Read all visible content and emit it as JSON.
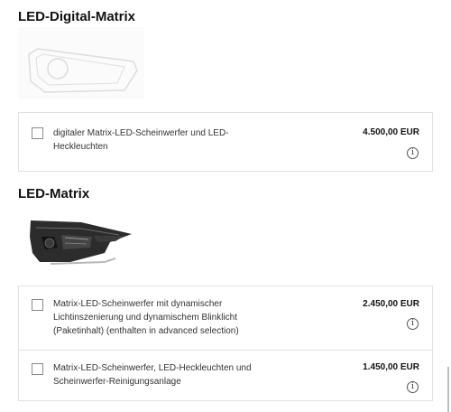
{
  "sections": [
    {
      "title": "LED-Digital-Matrix",
      "image_name": "led-digital-matrix-headlight-outline",
      "options": [
        {
          "text": "digitaler Matrix-LED-Scheinwerfer und LED-Heckleuchten",
          "price": "4.500,00 EUR",
          "checked": false,
          "info_icon": "info-icon"
        }
      ]
    },
    {
      "title": "LED-Matrix",
      "image_name": "led-matrix-headlight-photo",
      "options": [
        {
          "text": "Matrix-LED-Scheinwerfer mit dynamischer Lichtinszenierung und dynamischem Blinklicht (Paketinhalt) (enthalten in advanced selection)",
          "price": "2.450,00 EUR",
          "checked": false,
          "info_icon": "info-icon"
        },
        {
          "text": "Matrix-LED-Scheinwerfer, LED-Heckleuchten und Scheinwerfer-Reinigungsanlage",
          "price": "1.450,00 EUR",
          "checked": false,
          "info_icon": "info-icon"
        }
      ]
    }
  ],
  "info_glyph": "i",
  "colors": {
    "text": "#1a1a1a",
    "border": "#e1e1e1",
    "checkbox_border": "#8a8a8a"
  }
}
